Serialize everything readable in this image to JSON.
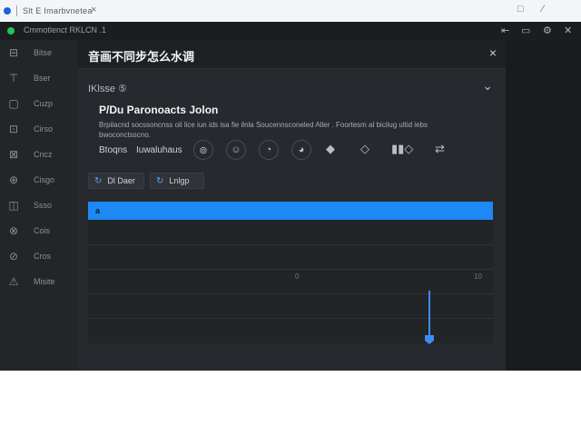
{
  "browser": {
    "tab_label": "Slt E Imarbvnetea",
    "close_glyph": "×",
    "new_tab_glyph": "□",
    "window_menu_glyph": "⁄"
  },
  "app": {
    "title": "Cmmotlenct RKLCN .1",
    "minimize_glyph": "⇤",
    "restore_glyph": "▭",
    "settings_glyph": "⚙",
    "close_glyph": "✕"
  },
  "sidebar": {
    "items": [
      {
        "icon": "⊟",
        "icon_name": "inbox-icon",
        "label": "Bitse"
      },
      {
        "icon": "⊤",
        "icon_name": "pin-icon",
        "label": "Bser"
      },
      {
        "icon": "▢",
        "icon_name": "window-icon",
        "label": "Cuzp"
      },
      {
        "icon": "⊡",
        "icon_name": "terminal-icon",
        "label": "Cirso"
      },
      {
        "icon": "⊠",
        "icon_name": "chat-icon",
        "label": "Cncz"
      },
      {
        "icon": "⊕",
        "icon_name": "plugin-icon",
        "label": "Cisgo"
      },
      {
        "icon": "◫",
        "icon_name": "shield-icon",
        "label": "Ssso"
      },
      {
        "icon": "⊗",
        "icon_name": "globe-icon",
        "label": "Cois"
      },
      {
        "icon": "⊘",
        "icon_name": "link-icon",
        "label": "Cros"
      },
      {
        "icon": "⚠",
        "icon_name": "warning-icon",
        "label": "Misite"
      }
    ]
  },
  "panel": {
    "title": "音画不同步怎么水调",
    "close_glyph": "×",
    "section_label": "IKlsse ⑤",
    "section_chevron": "⌄",
    "card_heading": "P/Du Paronoacts Jolon",
    "card_description": "Brpilacnd socssoncnss oil lice iun ids isa fie ilnla Soucennsconeled Aller .  Foortesm al bicilug ultid iebs bwoconctsscno.",
    "option_labels": [
      "Btoqns",
      "Iuwaluhaus"
    ],
    "icon_buttons": [
      "⊚",
      "☺",
      "◔",
      "◕"
    ],
    "bare_icons": [
      "◆",
      "◇",
      "▮▮◇",
      "⇄"
    ],
    "chips": [
      {
        "icon": "↻",
        "label": "Dl Daer"
      },
      {
        "icon": "↻",
        "label": "Lnlgp"
      }
    ]
  },
  "table": {
    "header_label": "a",
    "tick_left": "0",
    "tick_right": "10",
    "slider_value": 0.83
  },
  "colors": {
    "accent": "#1e88f5",
    "status_green": "#22c55e",
    "background": "#202326"
  }
}
